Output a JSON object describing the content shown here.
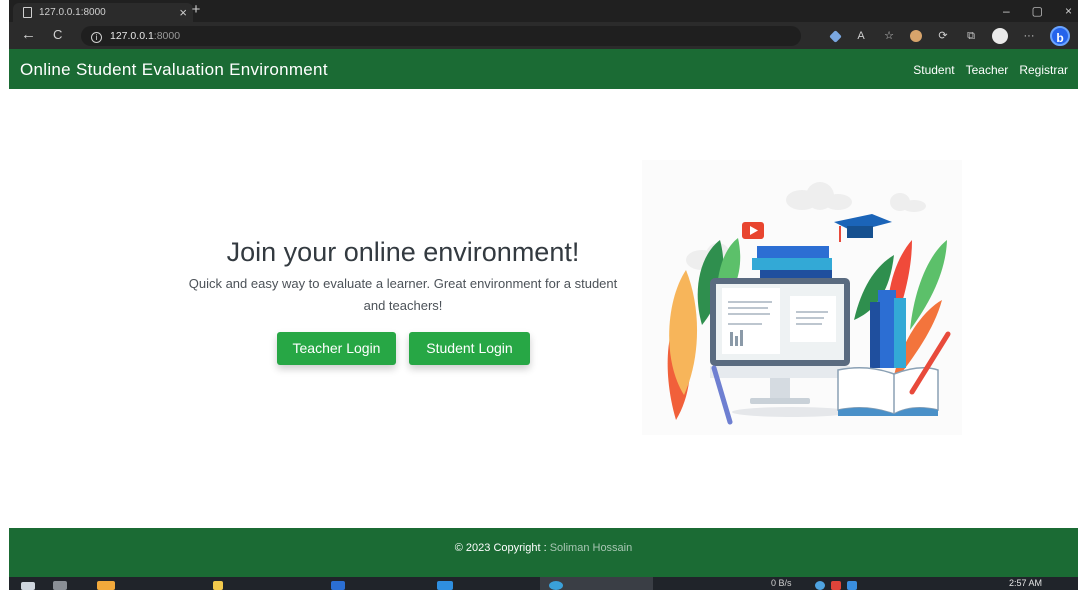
{
  "browser": {
    "tab_title": "127.0.0.1:8000",
    "url_host": "127.0.0.1",
    "url_port": ":8000",
    "close_glyph": "×",
    "new_tab_glyph": "+",
    "back_glyph": "←",
    "refresh_glyph": "C",
    "minimize_glyph": "–",
    "restore_glyph": "▢",
    "close_window_glyph": "×",
    "more_glyph": "···"
  },
  "navbar": {
    "brand": "Online Student Evaluation Environment",
    "links": [
      "Student",
      "Teacher",
      "Registrar"
    ],
    "bg_color": "#1b6b34"
  },
  "hero": {
    "title": "Join your online environment!",
    "subtitle": "Quick and easy way to evaluate a learner. Great environment for a student and teachers!",
    "teacher_button": "Teacher Login",
    "student_button": "Student Login",
    "button_color": "#27a745",
    "illustration_alt": "online learning illustration"
  },
  "footer": {
    "copyright": "© 2023 Copyright :",
    "author": "Soliman Hossain"
  },
  "taskbar": {
    "network": "0 B/s",
    "time": "2:57 AM"
  }
}
